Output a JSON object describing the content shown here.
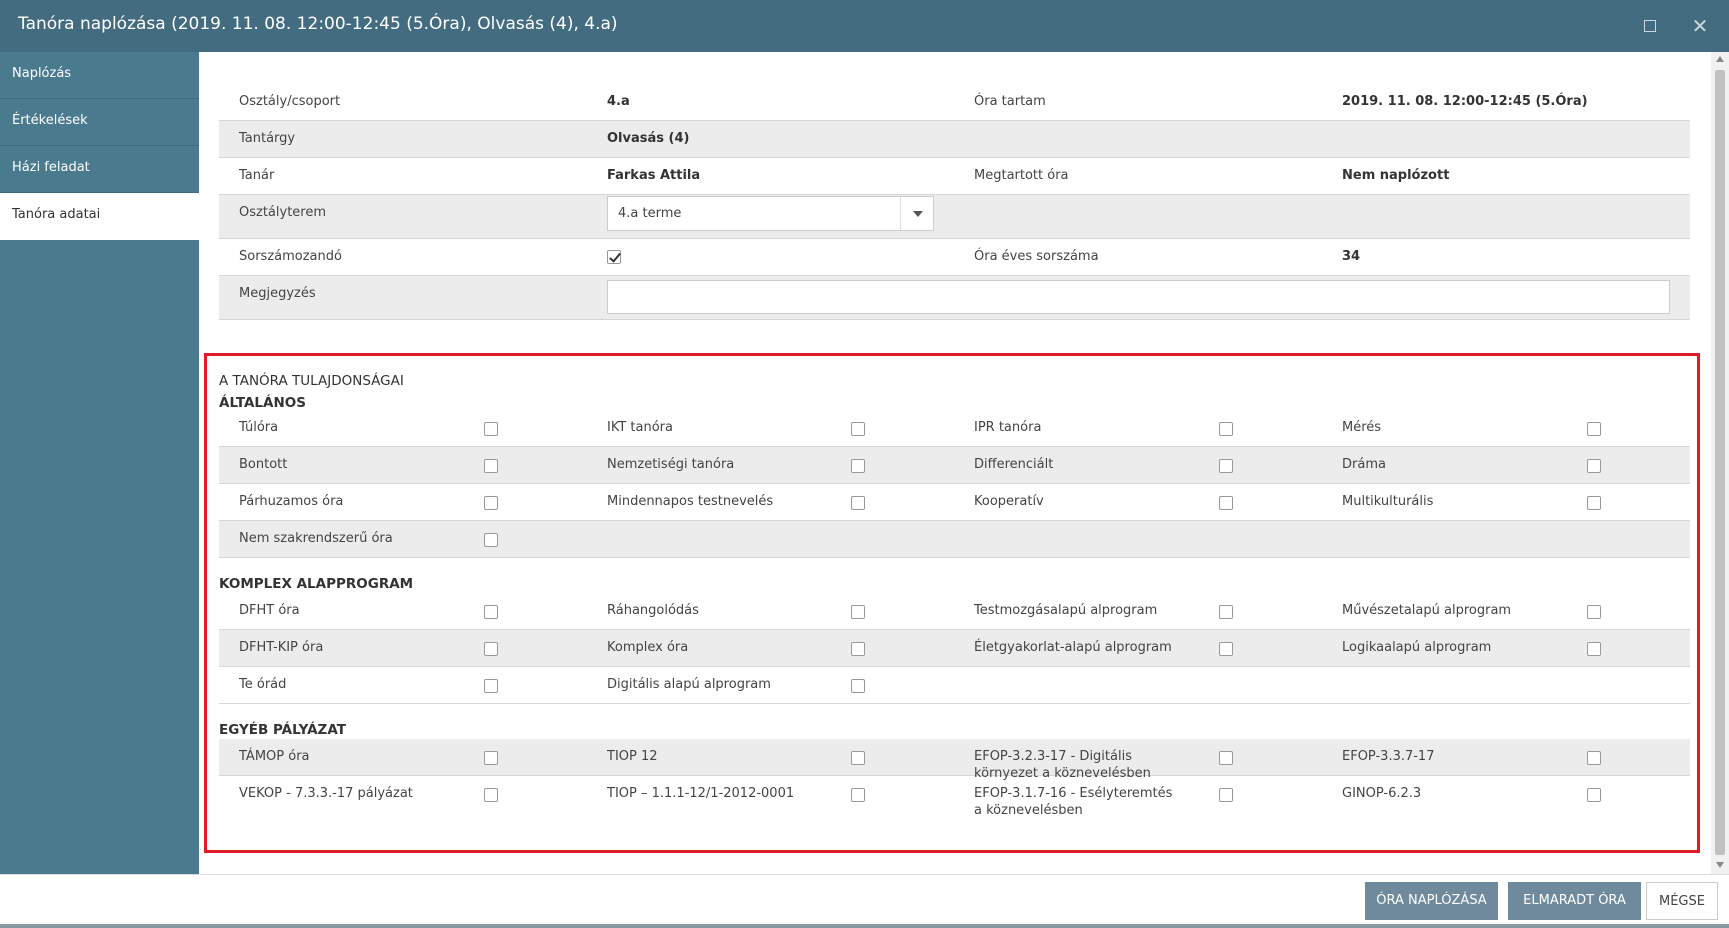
{
  "window": {
    "title": "Tanóra naplózása (2019. 11. 08. 12:00-12:45 (5.Óra), Olvasás (4), 4.a)"
  },
  "sidebar": {
    "items": [
      {
        "label": "Naplózás"
      },
      {
        "label": "Értékelések"
      },
      {
        "label": "Házi feladat"
      },
      {
        "label": "Tanóra adatai"
      }
    ],
    "active_index": 3
  },
  "info": {
    "class_label": "Osztály/csoport",
    "class_value": "4.a",
    "time_label": "Óra tartam",
    "time_value": "2019. 11. 08. 12:00-12:45 (5.Óra)",
    "subject_label": "Tantárgy",
    "subject_value": "Olvasás (4)",
    "teacher_label": "Tanár",
    "teacher_value": "Farkas Attila",
    "held_label": "Megtartott óra",
    "held_value": "Nem naplózott",
    "room_label": "Osztályterem",
    "room_value": "4.a terme",
    "numbered_label": "Sorszámozandó",
    "numbered_checked": true,
    "yearly_label": "Óra éves sorszáma",
    "yearly_value": "34",
    "note_label": "Megjegyzés",
    "note_value": ""
  },
  "props": {
    "section_title": "A TANÓRA TULAJDONSÁGAI",
    "general_title": "ÁLTALÁNOS",
    "general": [
      [
        "Túlóra",
        "IKT tanóra",
        "IPR tanóra",
        "Mérés"
      ],
      [
        "Bontott",
        "Nemzetiségi tanóra",
        "Differenciált",
        "Dráma"
      ],
      [
        "Párhuzamos óra",
        "Mindennapos testnevelés",
        "Kooperatív",
        "Multikulturális"
      ],
      [
        "Nem szakrendszerű óra"
      ]
    ],
    "complex_title": "KOMPLEX ALAPPROGRAM",
    "complex": [
      [
        "DFHT óra",
        "Ráhangolódás",
        "Testmozgásalapú alprogram",
        "Művészetalapú alprogram"
      ],
      [
        "DFHT-KIP óra",
        "Komplex óra",
        "Életgyakorlat-alapú alprogram",
        "Logikaalapú alprogram"
      ],
      [
        "Te órád",
        "Digitális alapú alprogram"
      ]
    ],
    "other_title": "EGYÉB PÁLYÁZAT",
    "other": [
      [
        "TÁMOP óra",
        "TIOP 12",
        "EFOP-3.2.3-17 - Digitális környezet a köznevelésben",
        "EFOP-3.3.7-17"
      ],
      [
        "VEKOP - 7.3.3.-17 pályázat",
        "TIOP – 1.1.1-12/1-2012-0001",
        "EFOP-3.1.7-16 - Esélyteremtés a köznevelésben",
        "GINOP-6.2.3"
      ]
    ]
  },
  "footer": {
    "log_button": "ÓRA NAPLÓZÁSA",
    "missed_button": "ELMARADT ÓRA",
    "cancel_button": "MÉGSE"
  },
  "colors": {
    "titlebar": "#436c80",
    "sidebar": "#4a7a8e",
    "highlight": "#e01b24",
    "primary_button": "#6e8a9c"
  },
  "icons": [
    "maximize-icon",
    "close-icon",
    "dropdown-caret-icon",
    "checkbox-icon"
  ]
}
